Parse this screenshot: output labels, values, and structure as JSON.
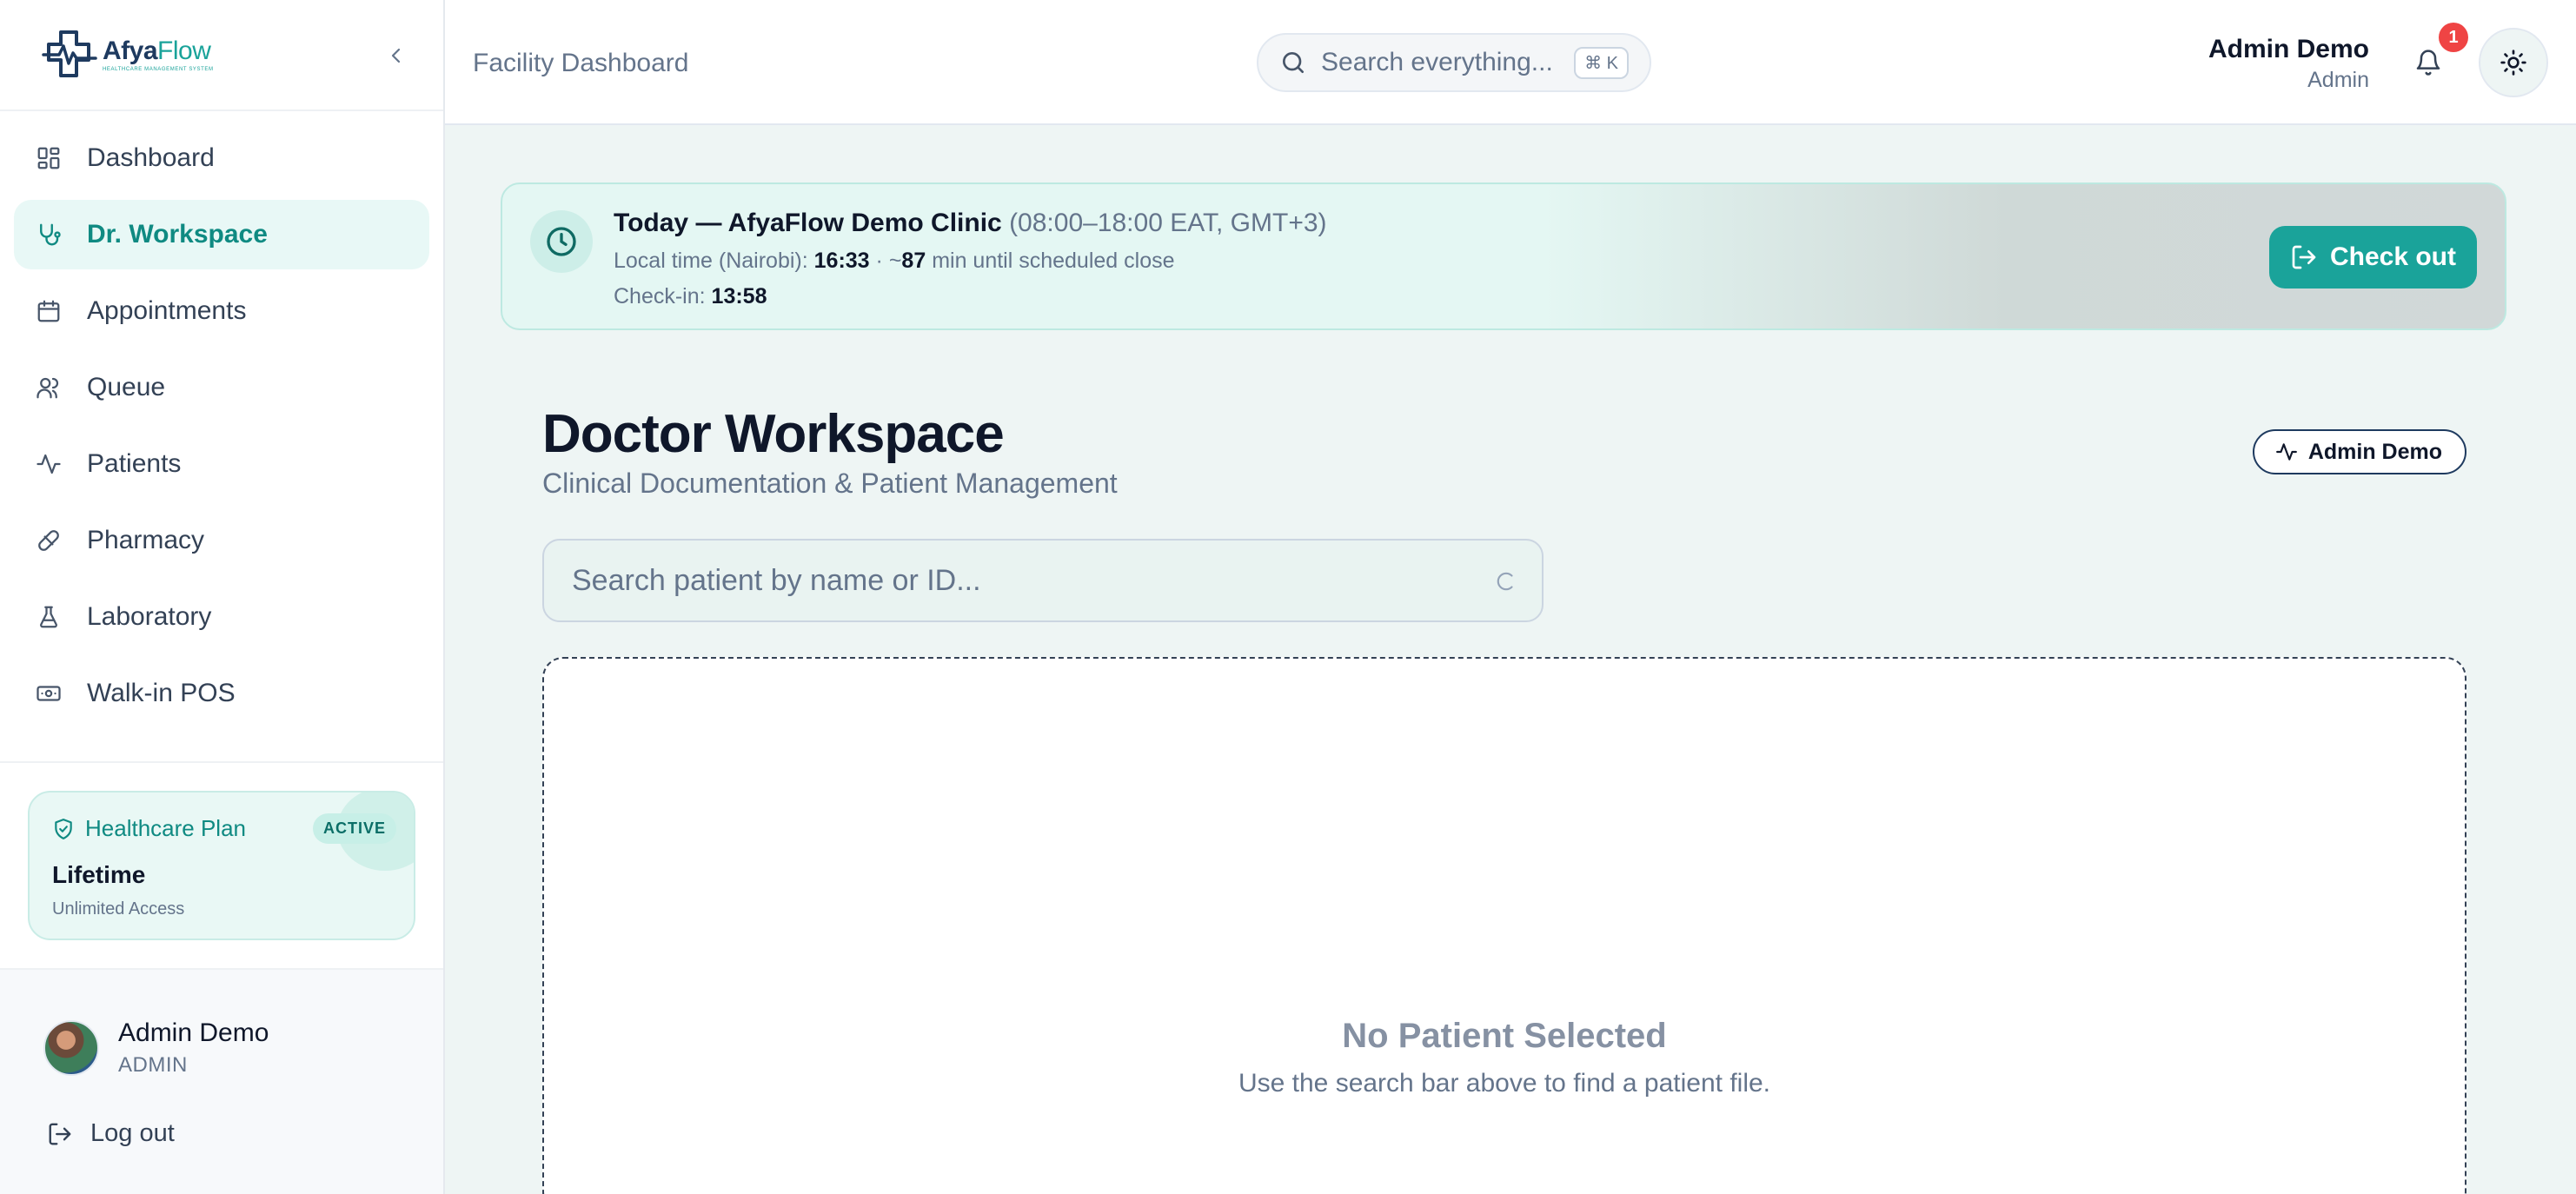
{
  "brand": {
    "name_part1": "Afya",
    "name_part2": "Flow",
    "tagline": "HEALTHCARE MANAGEMENT SYSTEM"
  },
  "sidebar": {
    "items": [
      {
        "label": "Dashboard",
        "icon": "layout-grid-icon",
        "active": false
      },
      {
        "label": "Dr. Workspace",
        "icon": "stethoscope-icon",
        "active": true
      },
      {
        "label": "Appointments",
        "icon": "calendar-icon",
        "active": false
      },
      {
        "label": "Queue",
        "icon": "users-icon",
        "active": false
      },
      {
        "label": "Patients",
        "icon": "activity-icon",
        "active": false
      },
      {
        "label": "Pharmacy",
        "icon": "pill-icon",
        "active": false
      },
      {
        "label": "Laboratory",
        "icon": "flask-icon",
        "active": false
      },
      {
        "label": "Walk-in POS",
        "icon": "banknote-icon",
        "active": false
      }
    ],
    "plan": {
      "title": "Healthcare Plan",
      "badge": "ACTIVE",
      "name": "Lifetime",
      "subtitle": "Unlimited Access"
    },
    "user": {
      "name": "Admin Demo",
      "role": "ADMIN"
    },
    "logout_label": "Log out"
  },
  "header": {
    "title": "Facility Dashboard",
    "search_placeholder": "Search everything...",
    "shortcut": "⌘ K",
    "user_name": "Admin Demo",
    "user_role": "Admin",
    "notification_count": "1"
  },
  "banner": {
    "title": "Today — AfyaFlow Demo Clinic",
    "hours": "(08:00–18:00 EAT, GMT+3)",
    "local_time_label": "Local time (Nairobi):",
    "local_time": "16:33",
    "close_prefix": "· ~",
    "minutes_until_close": "87",
    "close_suffix": "min until scheduled close",
    "checkin_label": "Check-in:",
    "checkin_time": "13:58",
    "checkout_label": "Check out"
  },
  "workspace": {
    "title": "Doctor Workspace",
    "subtitle": "Clinical Documentation & Patient Management",
    "user_badge": "Admin Demo",
    "search_placeholder": "Search patient by name or ID...",
    "empty_title": "No Patient Selected",
    "empty_subtitle": "Use the search bar above to find a patient file."
  },
  "colors": {
    "accent": "#1aa39a",
    "accent_light": "#e8f8f6",
    "brand_navy": "#1e3a5f",
    "notification": "#ef4444"
  }
}
